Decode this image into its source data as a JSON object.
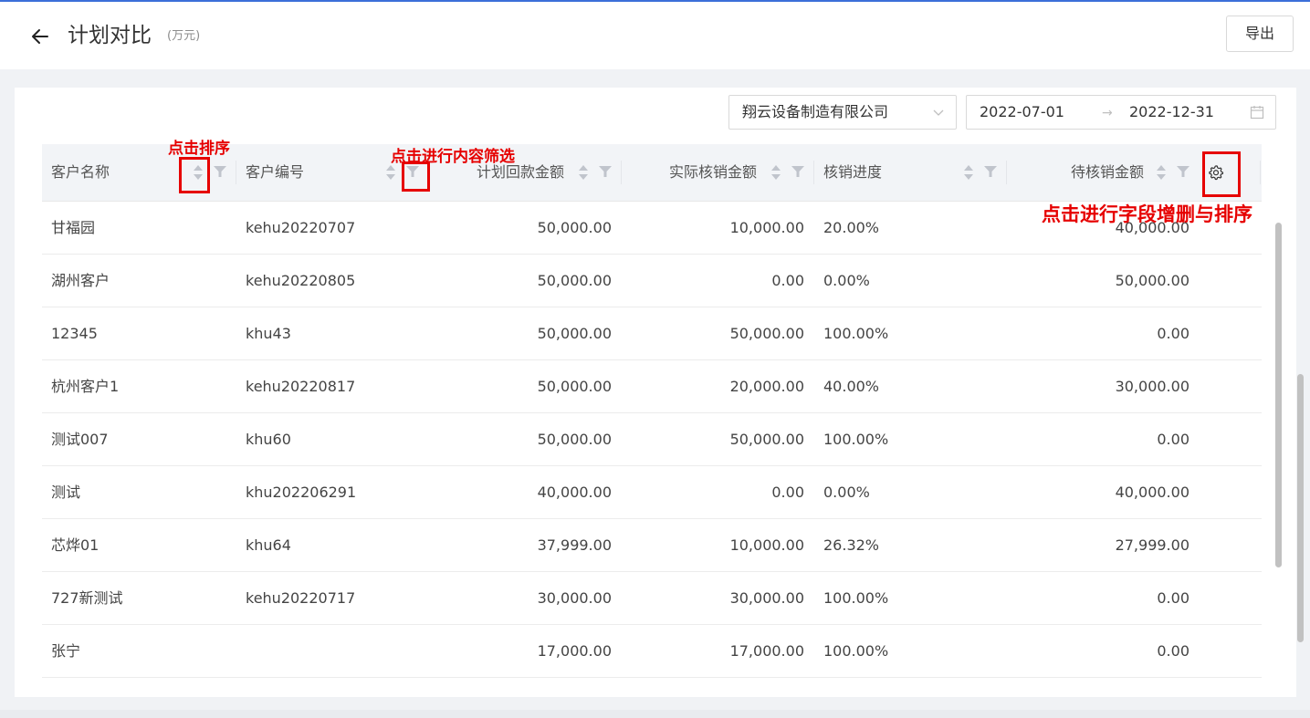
{
  "header": {
    "back_icon": "arrow-left-icon",
    "title": "计划对比",
    "unit": "(万元)",
    "export_label": "导出"
  },
  "filters": {
    "company": "翔云设备制造有限公司",
    "company_icon": "chevron-down-icon",
    "date_start": "2022-07-01",
    "date_sep": "→",
    "date_end": "2022-12-31",
    "calendar_icon": "calendar-icon"
  },
  "table": {
    "columns": [
      "客户名称",
      "客户编号",
      "计划回款金额",
      "实际核销金额",
      "核销进度",
      "待核销金额"
    ],
    "settings_icon": "gear-icon",
    "rows": [
      [
        "甘福园",
        "kehu20220707",
        "50,000.00",
        "10,000.00",
        "20.00%",
        "40,000.00"
      ],
      [
        "湖州客户",
        "kehu20220805",
        "50,000.00",
        "0.00",
        "0.00%",
        "50,000.00"
      ],
      [
        "12345",
        "khu43",
        "50,000.00",
        "50,000.00",
        "100.00%",
        "0.00"
      ],
      [
        "杭州客户1",
        "kehu20220817",
        "50,000.00",
        "20,000.00",
        "40.00%",
        "30,000.00"
      ],
      [
        "测试007",
        "khu60",
        "50,000.00",
        "50,000.00",
        "100.00%",
        "0.00"
      ],
      [
        "测试",
        "khu202206291",
        "40,000.00",
        "0.00",
        "0.00%",
        "40,000.00"
      ],
      [
        "芯烨01",
        "khu64",
        "37,999.00",
        "10,000.00",
        "26.32%",
        "27,999.00"
      ],
      [
        "727新测试",
        "kehu20220717",
        "30,000.00",
        "30,000.00",
        "100.00%",
        "0.00"
      ],
      [
        "张宁",
        "",
        "17,000.00",
        "17,000.00",
        "100.00%",
        "0.00"
      ]
    ]
  },
  "annotations": {
    "sort": "点击排序",
    "filter": "点击进行内容筛选",
    "settings": "点击进行字段增删与排序",
    "color": "#e60000"
  },
  "colors": {
    "accent": "#3b6fd9",
    "header_bg": "#f2f4f7"
  }
}
